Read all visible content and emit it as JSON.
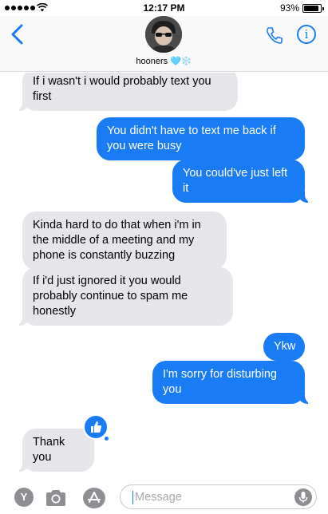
{
  "status_bar": {
    "time": "12:17 PM",
    "battery": "93%"
  },
  "header": {
    "contact_name": "hooners 🩵❄️"
  },
  "messages": [
    {
      "from": "them",
      "text": "If i wasn't i would probably text you first"
    },
    {
      "from": "me",
      "text": "You didn't have to text me back if you were busy"
    },
    {
      "from": "me",
      "text": "You could've just left it"
    },
    {
      "from": "them",
      "text": "Kinda hard to do that when i'm in the middle of a meeting and my phone is constantly buzzing"
    },
    {
      "from": "them",
      "text": "If i'd just ignored it you would probably continue to spam me honestly"
    },
    {
      "from": "me",
      "text": "Ykw"
    },
    {
      "from": "me",
      "text": "I'm sorry for disturbing you"
    },
    {
      "from": "them",
      "text": "Thank you"
    }
  ],
  "tapback": {
    "icon": "thumbs-up-icon",
    "color": "#1a7cf5"
  },
  "input": {
    "placeholder": "Message",
    "app_button_label": "Y"
  },
  "colors": {
    "outgoing": "#1a7cf5",
    "incoming": "#e5e5ea",
    "accent": "#1a7cf5"
  }
}
